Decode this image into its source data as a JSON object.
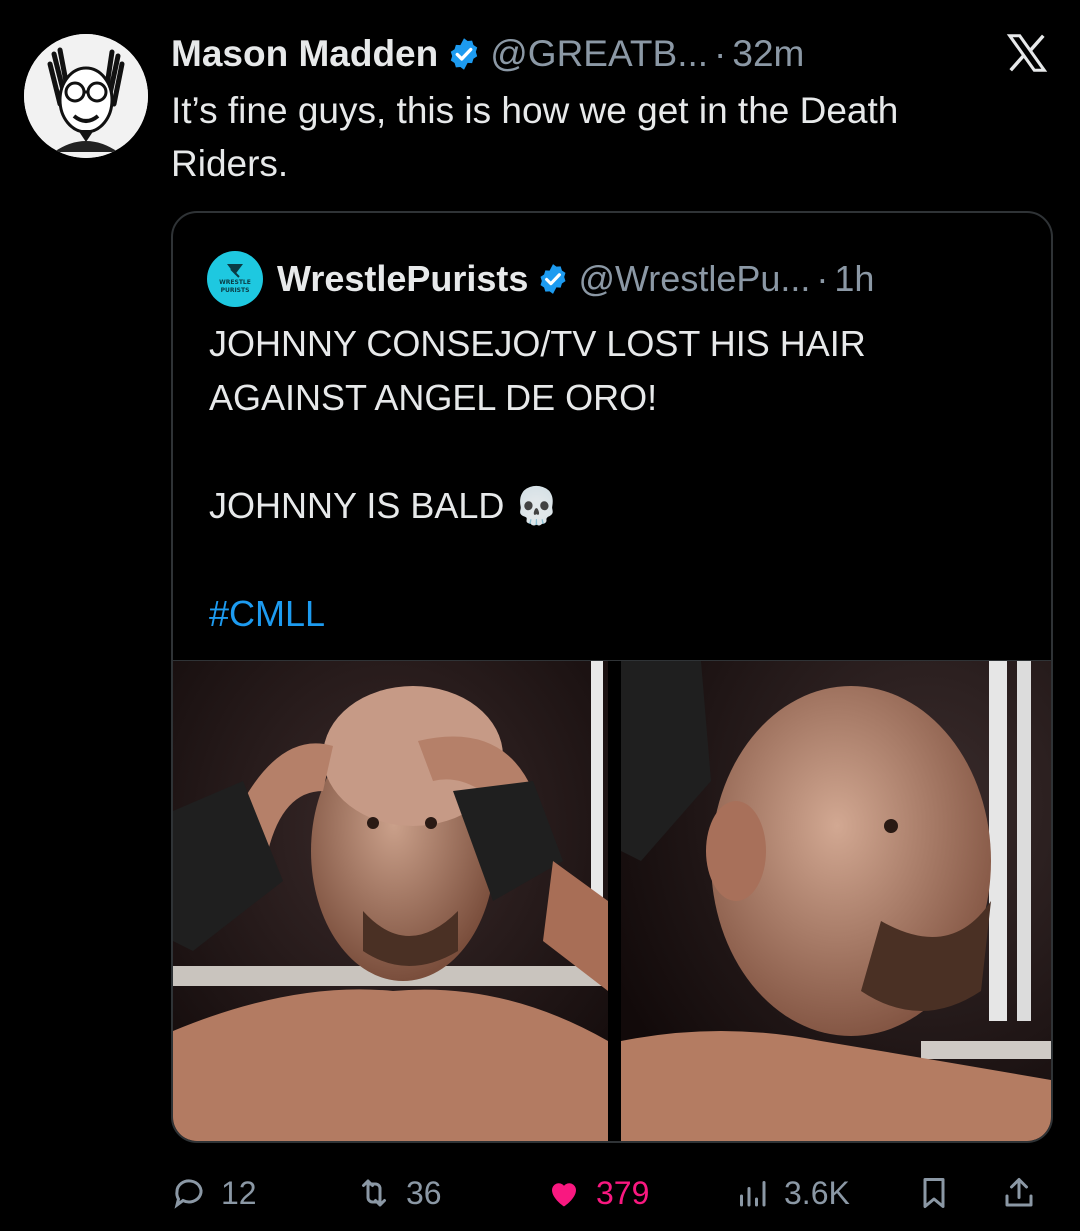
{
  "author": {
    "name": "Mason Madden",
    "handle": "@GREATB...",
    "separator": "·",
    "time": "32m"
  },
  "tweet": {
    "line1": "It’s fine guys, this is how we get in the Death",
    "line2": "Riders."
  },
  "quoted": {
    "name": "WrestlePurists",
    "handle": "@WrestlePu...",
    "separator": "·",
    "time": "1h",
    "avatar_text_1": "WRESTLE",
    "avatar_text_2": "PURISTS",
    "lines": [
      "JOHNNY CONSEJO/TV LOST HIS HAIR",
      "AGAINST ANGEL DE ORO!",
      "JOHNNY IS BALD 💀",
      "#CMLL"
    ]
  },
  "actions": {
    "replies": "12",
    "reposts": "36",
    "likes": "379",
    "views": "3.6K"
  },
  "colors": {
    "background": "#000000",
    "text": "#e7e9ea",
    "muted": "#8b98a5",
    "verified": "#1d9bf0",
    "hashtag": "#1d9bf0",
    "like": "#f91880",
    "border": "#2f3336"
  },
  "icons": [
    "verified-badge-icon",
    "x-logo-icon",
    "reply-icon",
    "repost-icon",
    "like-icon",
    "views-icon",
    "bookmark-icon",
    "share-icon"
  ]
}
